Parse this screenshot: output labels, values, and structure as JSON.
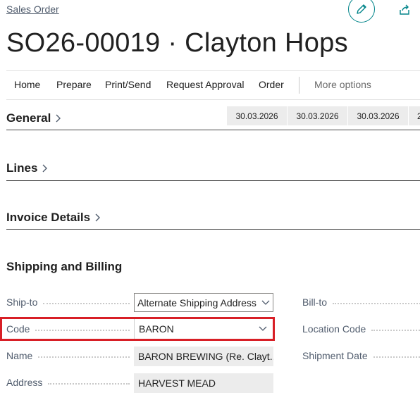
{
  "breadcrumb": "Sales Order",
  "title": "SO26-00019 · Clayton Hops",
  "icons": {
    "edit": "pencil-icon",
    "share": "share-icon"
  },
  "actions": [
    {
      "label": "Home"
    },
    {
      "label": "Prepare"
    },
    {
      "label": "Print/Send"
    },
    {
      "label": "Request Approval"
    },
    {
      "label": "Order"
    },
    {
      "label": "More options"
    }
  ],
  "sections": {
    "general": "General",
    "lines": "Lines",
    "invoice_details": "Invoice Details",
    "shipping_billing": "Shipping and Billing"
  },
  "general_dates": [
    "30.03.2026",
    "30.03.2026",
    "30.03.2026",
    "2"
  ],
  "fields": {
    "ship_to": {
      "label": "Ship-to",
      "value": "Alternate Shipping Address"
    },
    "code": {
      "label": "Code",
      "value": "BARON"
    },
    "name": {
      "label": "Name",
      "value": "BARON BREWING (Re. Clayt..."
    },
    "address": {
      "label": "Address",
      "value": "HARVEST MEAD"
    },
    "bill_to": {
      "label": "Bill-to"
    },
    "location_code": {
      "label": "Location Code"
    },
    "shipment_date": {
      "label": "Shipment Date"
    }
  },
  "colors": {
    "accent": "#008489",
    "highlight": "#d81f26",
    "readonly_bg": "#ececec"
  }
}
